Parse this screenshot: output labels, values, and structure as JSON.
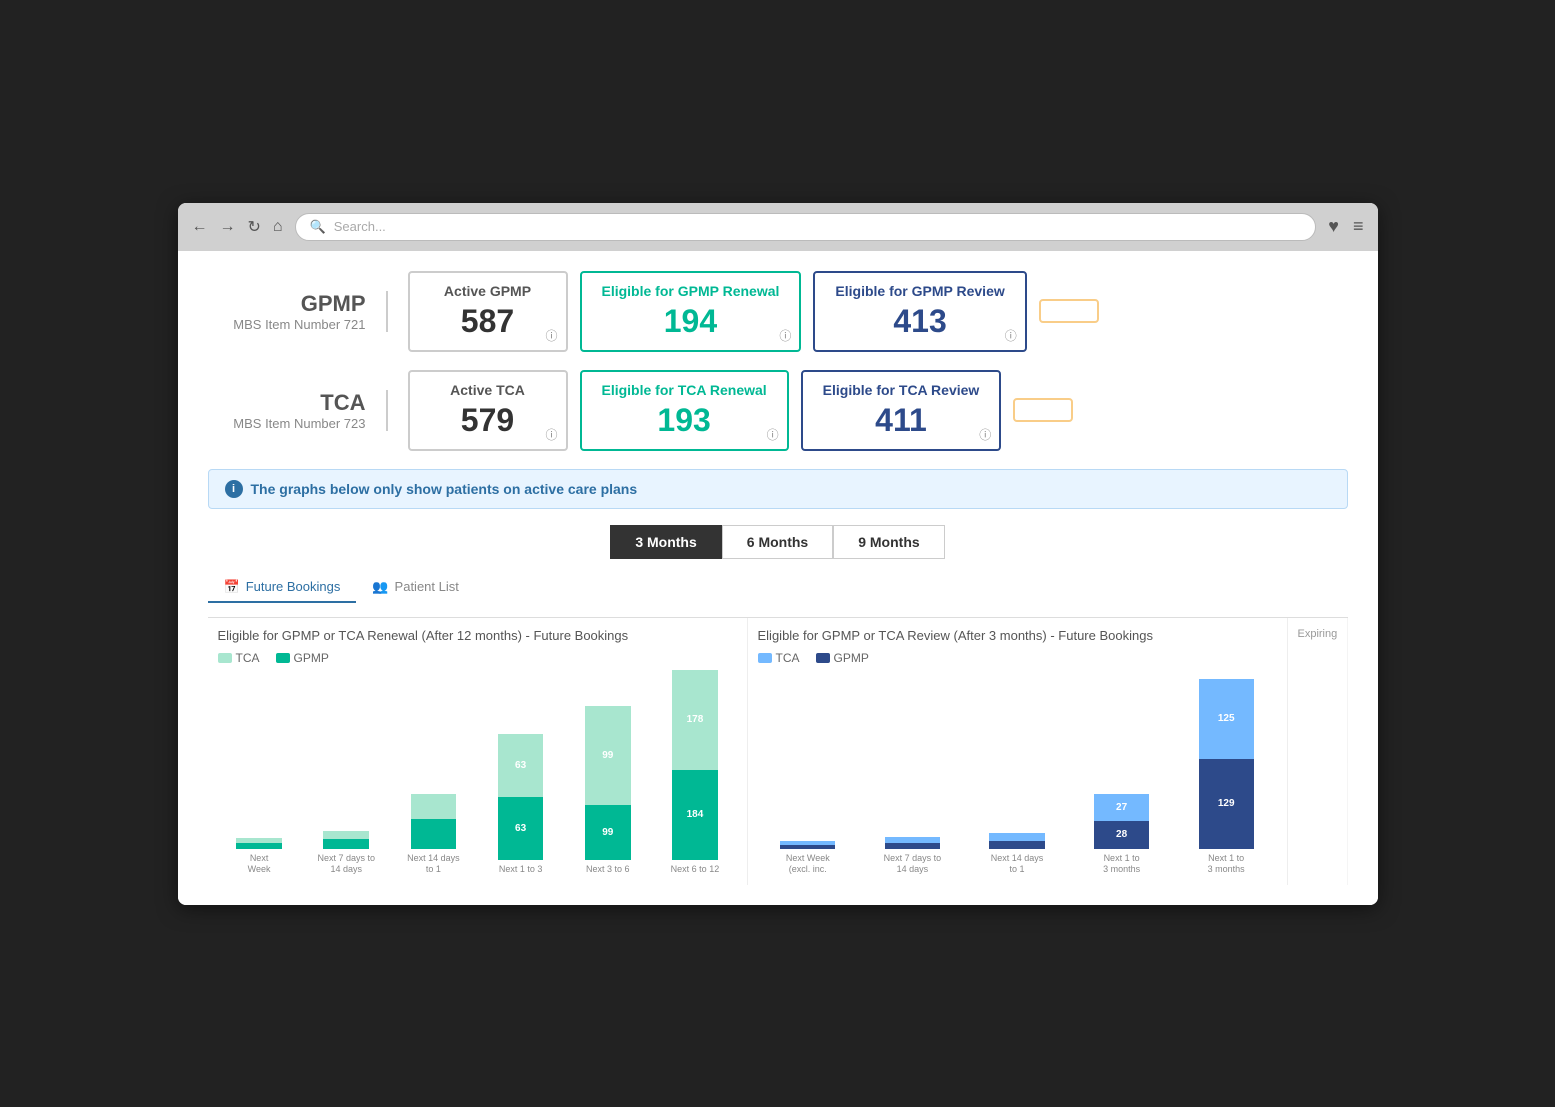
{
  "browser": {
    "search_placeholder": "Search...",
    "heart_icon": "♥",
    "menu_icon": "≡"
  },
  "gpmp": {
    "title": "GPMP",
    "subtitle": "MBS Item Number 721",
    "active": {
      "label": "Active GPMP",
      "value": "587"
    },
    "renewal": {
      "label": "Eligible for GPMP Renewal",
      "value": "194"
    },
    "review": {
      "label": "Eligible for GPMP Review",
      "value": "413"
    }
  },
  "tca": {
    "title": "TCA",
    "subtitle": "MBS Item Number 723",
    "active": {
      "label": "Active TCA",
      "value": "579"
    },
    "renewal": {
      "label": "Eligible for TCA Renewal",
      "value": "193"
    },
    "review": {
      "label": "Eligible for TCA Review",
      "value": "411"
    }
  },
  "info_banner": "The graphs below only show patients on active care plans",
  "time_filters": [
    {
      "label": "3 Months",
      "active": true
    },
    {
      "label": "6 Months",
      "active": false
    },
    {
      "label": "9 Months",
      "active": false
    }
  ],
  "tabs": [
    {
      "label": "Future Bookings",
      "icon": "📅",
      "active": true
    },
    {
      "label": "Patient List",
      "icon": "👥",
      "active": false
    }
  ],
  "chart1": {
    "title": "Eligible for GPMP or TCA Renewal (After 12 months) - Future Bookings",
    "legend": [
      {
        "label": "TCA",
        "color": "#a8e6cf"
      },
      {
        "label": "GPMP",
        "color": "#00b894"
      }
    ],
    "bars": [
      {
        "x_label": "Next Week",
        "tca": 3,
        "gpmp": 4,
        "tca_val": "",
        "gpmp_val": ""
      },
      {
        "x_label": "Next 7 days to 14 days",
        "tca": 5,
        "gpmp": 6,
        "tca_val": "",
        "gpmp_val": ""
      },
      {
        "x_label": "Next 14 days to 1",
        "tca": 25,
        "gpmp": 30,
        "tca_val": "",
        "gpmp_val": ""
      },
      {
        "x_label": "Next 1 to 3",
        "tca": 63,
        "gpmp": 63,
        "tca_val": "63",
        "gpmp_val": "63"
      },
      {
        "x_label": "Next 3 to 6",
        "tca": 99,
        "gpmp": 99,
        "tca_val": "99",
        "gpmp_val": "99"
      },
      {
        "x_label": "Next 6 to 12",
        "tca": 178,
        "gpmp": 184,
        "tca_val": "178",
        "gpmp_val": "184"
      }
    ]
  },
  "chart2": {
    "title": "Eligible for GPMP or TCA Review (After 3 months) - Future Bookings",
    "legend": [
      {
        "label": "TCA",
        "color": "#74b9ff"
      },
      {
        "label": "GPMP",
        "color": "#2d4a8a"
      }
    ],
    "bars": [
      {
        "x_label": "Next Week (excl. inc.",
        "tca": 2,
        "gpmp": 2,
        "tca_val": "",
        "gpmp_val": ""
      },
      {
        "x_label": "Next 7 days to 14 days",
        "tca": 3,
        "gpmp": 3,
        "tca_val": "",
        "gpmp_val": ""
      },
      {
        "x_label": "Next 14 days to 1",
        "tca": 4,
        "gpmp": 4,
        "tca_val": "",
        "gpmp_val": ""
      },
      {
        "x_label": "Next 1 to 3 months",
        "tca": 27,
        "gpmp": 28,
        "tca_val": "27",
        "gpmp_val": "28"
      },
      {
        "x_label": "Next 1 to 3 months (2)",
        "tca": 125,
        "gpmp": 129,
        "tca_val": "125",
        "gpmp_val": "129"
      }
    ]
  },
  "chart3": {
    "title": "Expiring",
    "visible": false
  }
}
